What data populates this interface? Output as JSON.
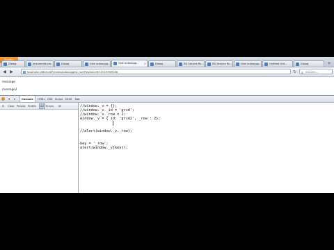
{
  "browser": {
    "menu_button": "Firefox",
    "tabs": [
      {
        "label": "Dialog"
      },
      {
        "label": "ensurendit.pro..."
      },
      {
        "label": "Dialog"
      },
      {
        "label": "Grdr autosugg..."
      },
      {
        "label": "Grdr autosugg..."
      },
      {
        "label": "Dialog"
      },
      {
        "label": "RD Service Ru..."
      },
      {
        "label": "RD Service Ru..."
      },
      {
        "label": "Grdr autosugg..."
      },
      {
        "label": "Untitled Grd..."
      },
      {
        "label": "Dialog"
      }
    ],
    "new_tab_label": "+",
    "url": "localhost:1080/LivePreview/autosuggest_LivePreview.cfm?1537090903b",
    "search_placeholder": "ensuren...",
    "search_engine_icon": "google-icon"
  },
  "page": {
    "message1": "message",
    "message2": "message2"
  },
  "firebug": {
    "tabs": [
      "Console",
      "HTML",
      "CSS",
      "Script",
      "DOM",
      "Net"
    ],
    "console_buttons": [
      "Clear",
      "Persist",
      "Profile",
      "All",
      "Errors",
      "W"
    ],
    "code_lines": [
      "//window._v = {};",
      "//window._v._id = 'grid';",
      "//window._v._row = 2;",
      "window._v = { id: 'grid2', _row : 2};",
      "",
      "",
      "//alert(window._v._row);",
      "",
      "",
      "key = '_row';",
      "alert(window._v[key]);"
    ]
  }
}
